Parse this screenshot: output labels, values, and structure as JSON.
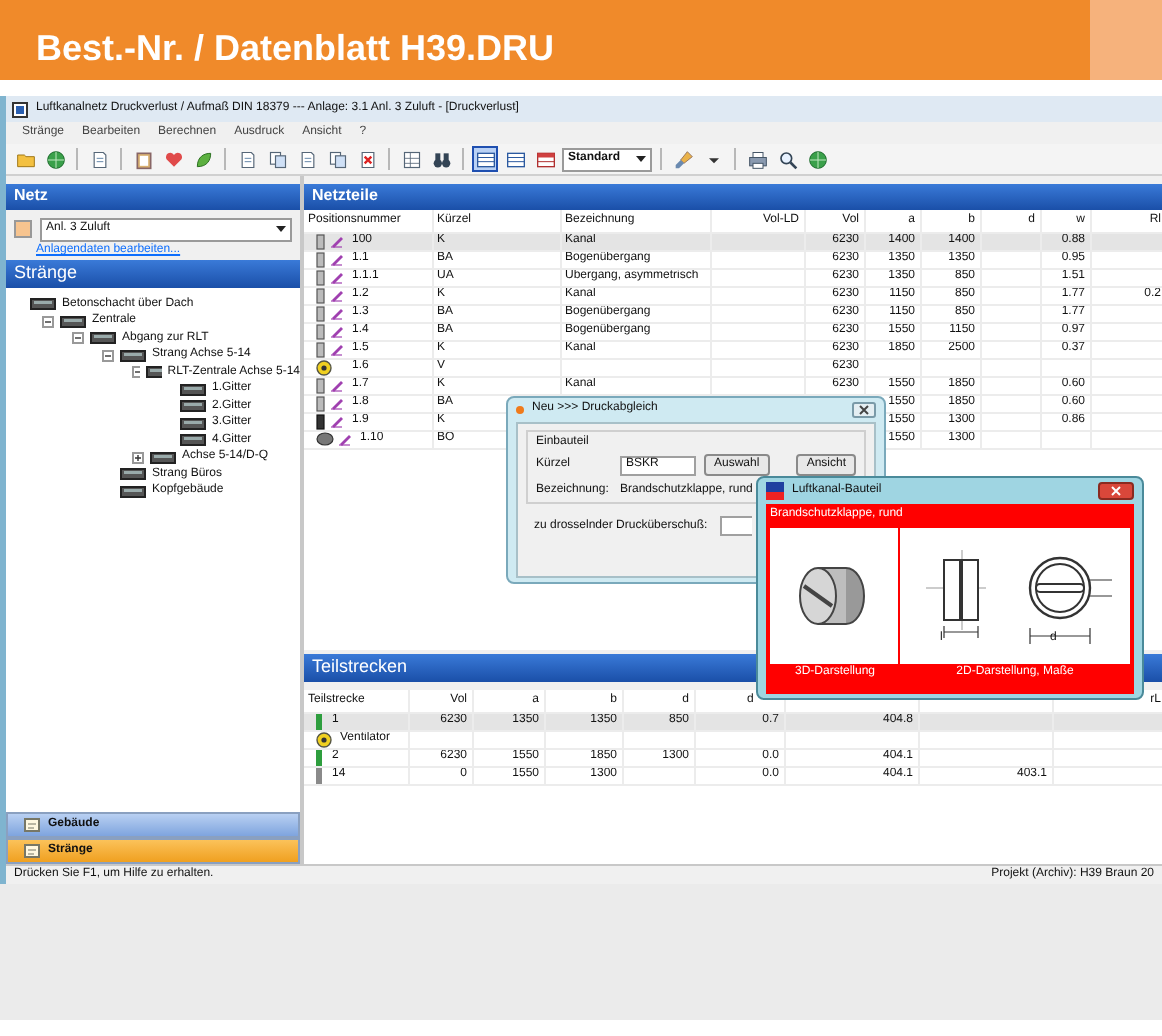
{
  "banner": {
    "title": "Best.-Nr. / Datenblatt H39.DRU"
  },
  "window": {
    "title": "Luftkanalnetz Druckverlust / Aufmaß DIN 18379 --- Anlage: 3.1 Anl. 3 Zuluft - [Druckverlust]"
  },
  "menu": [
    "Stränge",
    "Bearbeiten",
    "Berechnen",
    "Ausdruck",
    "Ansicht",
    "?"
  ],
  "toolbar": [
    {
      "kind": "folder",
      "pressed": false
    },
    {
      "kind": "globe",
      "pressed": false
    },
    {
      "kind": "sep"
    },
    {
      "kind": "page",
      "pressed": false
    },
    {
      "kind": "sep"
    },
    {
      "kind": "clipboard",
      "pressed": false
    },
    {
      "kind": "heart",
      "pressed": false
    },
    {
      "kind": "leaf",
      "pressed": false
    },
    {
      "kind": "sep"
    },
    {
      "kind": "page",
      "pressed": false
    },
    {
      "kind": "copy",
      "pressed": false
    },
    {
      "kind": "page",
      "pressed": false
    },
    {
      "kind": "copy",
      "pressed": false
    },
    {
      "kind": "delete",
      "pressed": false
    },
    {
      "kind": "sep"
    },
    {
      "kind": "grid",
      "pressed": false
    },
    {
      "kind": "binoculars",
      "pressed": false
    },
    {
      "kind": "sep"
    },
    {
      "kind": "table",
      "pressed": true
    },
    {
      "kind": "table",
      "pressed": false
    },
    {
      "kind": "tablered",
      "pressed": false
    },
    {
      "kind": "dropdown",
      "label": "Standard",
      "pressed": false
    },
    {
      "kind": "sep"
    },
    {
      "kind": "brush",
      "pressed": false
    },
    {
      "kind": "caret",
      "pressed": false
    },
    {
      "kind": "sep"
    },
    {
      "kind": "printer",
      "pressed": false
    },
    {
      "kind": "search",
      "pressed": false
    },
    {
      "kind": "globe",
      "pressed": false
    }
  ],
  "netz": {
    "title": "Netz",
    "plant": "Anl. 3 Zuluft",
    "link": "Anlagendaten bearbeiten..."
  },
  "straenge": {
    "title": "Stränge",
    "tree": [
      {
        "label": "Betonschacht über Dach",
        "children": [
          {
            "label": "Zentrale",
            "expanded": true,
            "children": [
              {
                "label": "Abgang zur RLT",
                "expanded": true,
                "children": [
                  {
                    "label": "Strang Achse 5-14",
                    "expanded": true,
                    "children": [
                      {
                        "label": "RLT-Zentrale Achse 5-14",
                        "expanded": true,
                        "children": [
                          {
                            "label": "1.Gitter"
                          },
                          {
                            "label": "2.Gitter"
                          },
                          {
                            "label": "3.Gitter"
                          },
                          {
                            "label": "4.Gitter"
                          }
                        ]
                      },
                      {
                        "label": "Achse 5-14/D-Q",
                        "expanded": false
                      }
                    ]
                  },
                  {
                    "label": "Strang Büros"
                  },
                  {
                    "label": "Kopfgebäude"
                  }
                ]
              }
            ]
          }
        ]
      }
    ]
  },
  "nav": [
    {
      "label": "Gebäude",
      "selected": false
    },
    {
      "label": "Stränge",
      "selected": true
    }
  ],
  "netzteile": {
    "title": "Netzteile",
    "columns": [
      "Positionsnummer",
      "Kürzel",
      "Bezeichnung",
      "Vol-LD",
      "Vol",
      "a",
      "b",
      "d",
      "w",
      "Rl"
    ],
    "rows": [
      {
        "kind": "duct",
        "selected": true,
        "cells": [
          "100",
          "K",
          "Kanal",
          null,
          "6230",
          "1400",
          "1400",
          null,
          "0.88",
          null
        ]
      },
      {
        "kind": "duct",
        "selected": false,
        "cells": [
          "1.1",
          "BA",
          "Bogenübergang",
          null,
          "6230",
          "1350",
          "1350",
          null,
          "0.95",
          null
        ]
      },
      {
        "kind": "duct",
        "selected": false,
        "cells": [
          "1.1.1",
          "UA",
          "Übergang, asymmetrisch",
          null,
          "6230",
          "1350",
          "850",
          null,
          "1.51",
          null
        ]
      },
      {
        "kind": "duct",
        "selected": false,
        "cells": [
          "1.2",
          "K",
          "Kanal",
          null,
          "6230",
          "1150",
          "850",
          null,
          "1.77",
          "0.2"
        ]
      },
      {
        "kind": "duct",
        "selected": false,
        "cells": [
          "1.3",
          "BA",
          "Bogenübergang",
          null,
          "6230",
          "1150",
          "850",
          null,
          "1.77",
          null
        ]
      },
      {
        "kind": "duct",
        "selected": false,
        "cells": [
          "1.4",
          "BA",
          "Bogenübergang",
          null,
          "6230",
          "1550",
          "1150",
          null,
          "0.97",
          null
        ]
      },
      {
        "kind": "duct",
        "selected": false,
        "cells": [
          "1.5",
          "K",
          "Kanal",
          null,
          "6230",
          "1850",
          "2500",
          null,
          "0.37",
          null
        ]
      },
      {
        "kind": "fan",
        "selected": false,
        "cells": [
          "1.6",
          "V",
          null,
          null,
          "6230",
          null,
          null,
          null,
          null,
          null
        ]
      },
      {
        "kind": "duct",
        "selected": false,
        "cells": [
          "1.7",
          "K",
          "Kanal",
          null,
          "6230",
          "1550",
          "1850",
          null,
          "0.60",
          null
        ]
      },
      {
        "kind": "duct",
        "selected": false,
        "cells": [
          "1.8",
          "BA",
          null,
          null,
          null,
          "1550",
          "1850",
          null,
          "0.60",
          null
        ]
      },
      {
        "kind": "damper",
        "selected": false,
        "cells": [
          "1.9",
          "K",
          null,
          null,
          null,
          "1550",
          "1300",
          null,
          "0.86",
          null
        ]
      },
      {
        "kind": "round",
        "selected": false,
        "cells": [
          "1.10",
          "BO",
          null,
          null,
          null,
          "1550",
          "1300",
          null,
          null,
          null
        ]
      }
    ]
  },
  "teilstrecken": {
    "title": "Teilstrecken",
    "columns": [
      "Teilstrecke",
      "Vol",
      "a",
      "b",
      "d",
      "d",
      null,
      null,
      "rL"
    ],
    "rows": [
      {
        "kind": "segment",
        "color": "#2e9e3e",
        "selected": true,
        "cells": [
          "1",
          "6230",
          "1350",
          "1350",
          "850",
          "0.7",
          "404.8",
          null,
          null
        ]
      },
      {
        "kind": "fan",
        "selected": false,
        "cells": [
          "Ventilator",
          null,
          null,
          null,
          null,
          null,
          null,
          null,
          null
        ]
      },
      {
        "kind": "segment",
        "color": "#2e9e3e",
        "selected": false,
        "cells": [
          "2",
          "6230",
          "1550",
          "1850",
          "1300",
          "0.0",
          "404.1",
          null,
          null
        ]
      },
      {
        "kind": "segment",
        "color": "#8a8a8a",
        "selected": false,
        "cells": [
          "14",
          "0",
          "1550",
          "1300",
          null,
          "0.0",
          "404.1",
          "403.1",
          null
        ]
      }
    ]
  },
  "dialog": {
    "title": "Neu >>> Druckabgleich",
    "group": "Einbauteil",
    "code_label": "Kürzel",
    "code": "BSKR",
    "select_button": "Auswahl",
    "view_button": "Ansicht",
    "name_label": "Bezeichnung:",
    "name": "Brandschutzklappe, rund",
    "pressure_label": "zu drosselnder Drucküberschuß:"
  },
  "component_window": {
    "title": "Luftkanal-Bauteil",
    "name": "Brandschutzklappe, rund",
    "dimension_labels": [
      "l",
      "d"
    ],
    "caption_3d": "3D-Darstellung",
    "caption_2d": "2D-Darstellung, Maße"
  },
  "status_bar": {
    "help": "Drücken Sie F1, um Hilfe zu erhalten.",
    "project": "Projekt (Archiv): H39 Braun 20"
  }
}
